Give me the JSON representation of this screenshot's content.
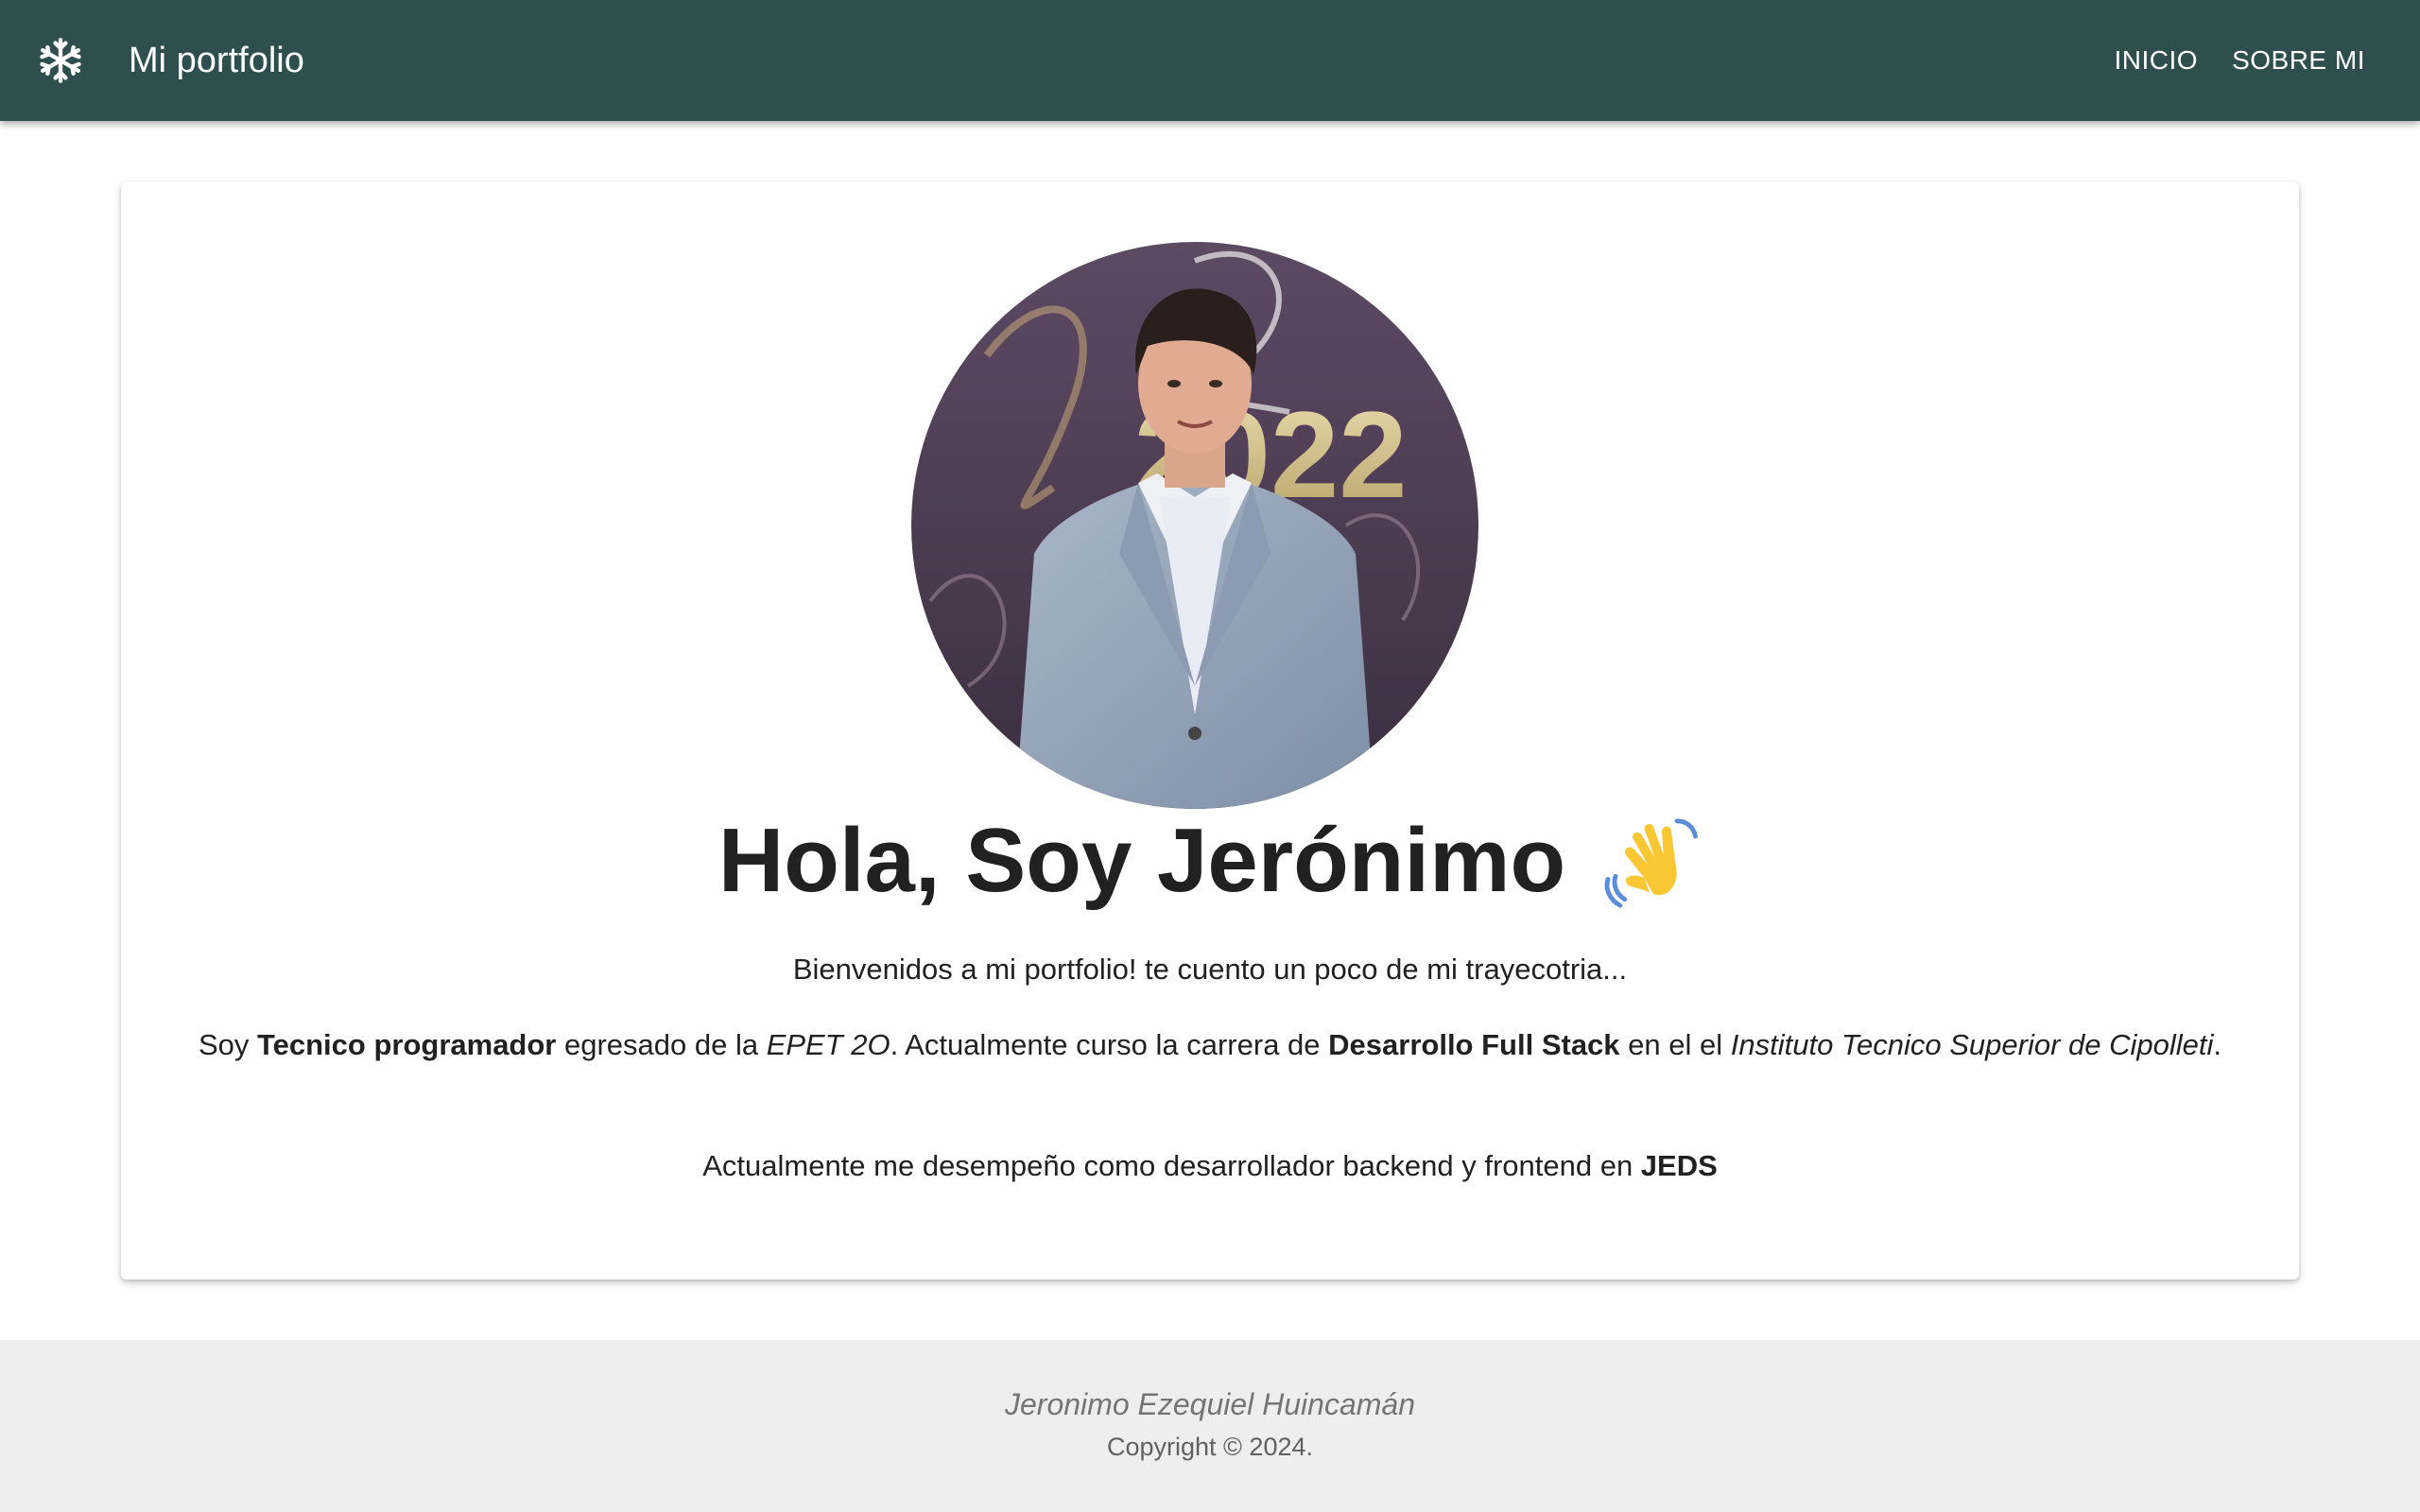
{
  "header": {
    "brand_icon": "snowflake-icon",
    "title": "Mi portfolio",
    "nav": [
      {
        "label": "INICIO"
      },
      {
        "label": "SOBRE MI"
      }
    ],
    "bar_color": "#2f4f4f"
  },
  "main": {
    "headline": "Hola, Soy Jerónimo",
    "headline_icon": "waving-hand-icon",
    "welcome": "Bienvenidos a mi portfolio! te cuento un poco de mi trayecotria...",
    "bio": {
      "t1": "Soy ",
      "b1": "Tecnico programador",
      "t2": " egresado de la ",
      "i1": "EPET 2O",
      "t3": ". Actualmente curso la carrera de ",
      "b2": "Desarrollo Full Stack",
      "t4": " en el el ",
      "i2": "Instituto Tecnico Superior de Cipolleti",
      "t5": "."
    },
    "job": {
      "text": "Actualmente me desempeño como desarrollador backend y frontend en ",
      "company": "JEDS"
    },
    "photo": {
      "banner_text": "2022"
    }
  },
  "footer": {
    "name": "Jeronimo Ezequiel Huincamán",
    "copyright": "Copyright © 2024."
  }
}
